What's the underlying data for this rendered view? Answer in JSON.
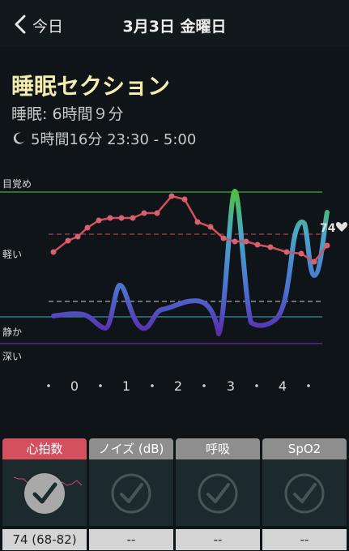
{
  "header": {
    "back_label": "今日",
    "title": "3月3日 金曜日"
  },
  "section": {
    "title": "睡眠セクション",
    "sleep_label": "睡眠: 6時間９分",
    "range_text": "5時間16分 23:30 - 5:00"
  },
  "chart": {
    "y_labels": [
      "目覚め",
      "軽い",
      "静か",
      "深い"
    ],
    "x_ticks": [
      "0",
      "1",
      "2",
      "3",
      "4"
    ],
    "hr_end_label": "74"
  },
  "panels": [
    {
      "label": "心拍数",
      "value": "74 (68-82)"
    },
    {
      "label": "ノイズ (dB)",
      "value": "--"
    },
    {
      "label": "呼吸",
      "value": "--"
    },
    {
      "label": "SpO2",
      "value": "--"
    }
  ],
  "colors": {
    "accent_red": "#d4505f",
    "panel_gray": "#8e8e8e",
    "title_yellow": "#f5edb0"
  }
}
